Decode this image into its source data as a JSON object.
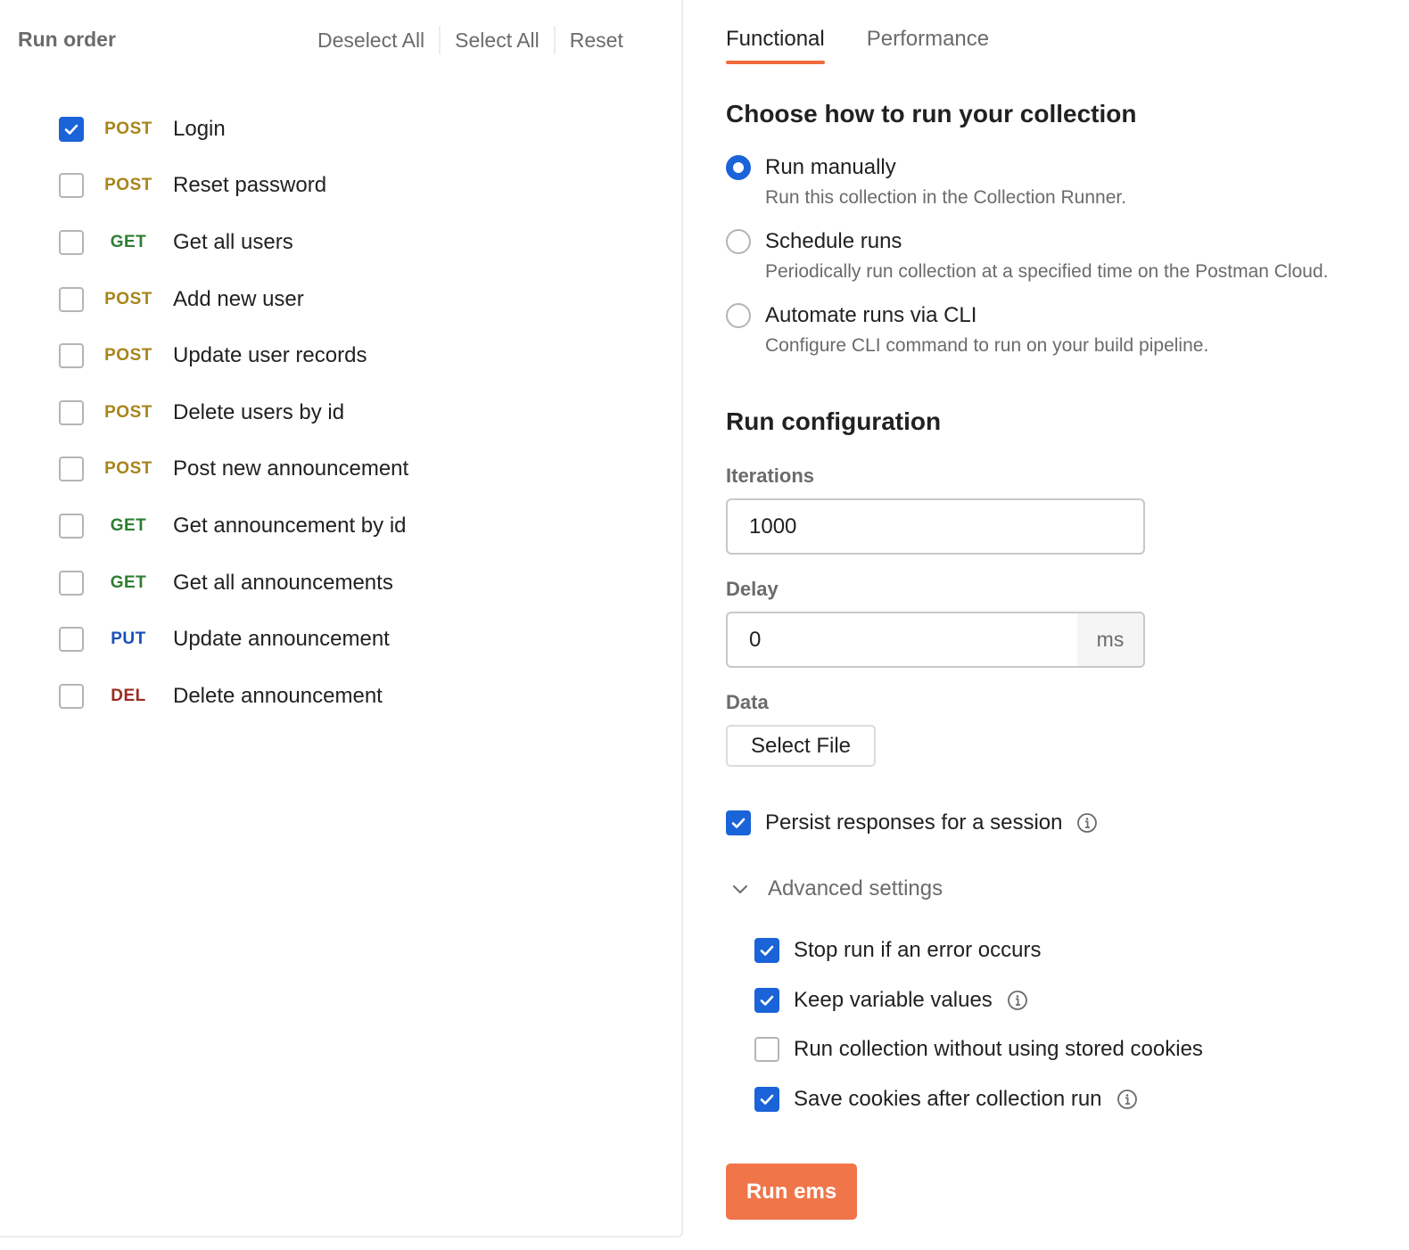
{
  "left": {
    "title": "Run order",
    "actions": {
      "deselect_all": "Deselect All",
      "select_all": "Select All",
      "reset": "Reset"
    },
    "requests": [
      {
        "method": "POST",
        "name": "Login",
        "checked": true
      },
      {
        "method": "POST",
        "name": "Reset password",
        "checked": false
      },
      {
        "method": "GET",
        "name": "Get all users",
        "checked": false
      },
      {
        "method": "POST",
        "name": "Add new user",
        "checked": false
      },
      {
        "method": "POST",
        "name": "Update user records",
        "checked": false
      },
      {
        "method": "POST",
        "name": "Delete users by id",
        "checked": false
      },
      {
        "method": "POST",
        "name": "Post new announcement",
        "checked": false
      },
      {
        "method": "GET",
        "name": "Get announcement by id",
        "checked": false
      },
      {
        "method": "GET",
        "name": "Get all announcements",
        "checked": false
      },
      {
        "method": "PUT",
        "name": "Update announcement",
        "checked": false
      },
      {
        "method": "DEL",
        "name": "Delete announcement",
        "checked": false
      }
    ]
  },
  "method_colors": {
    "POST": "#a8841a",
    "GET": "#2e7d32",
    "PUT": "#1a4fb8",
    "DEL": "#9c2a1f"
  },
  "tabs": {
    "functional": "Functional",
    "performance": "Performance",
    "active": "functional"
  },
  "run_mode": {
    "title": "Choose how to run your collection",
    "options": [
      {
        "label": "Run manually",
        "desc": "Run this collection in the Collection Runner.",
        "selected": true
      },
      {
        "label": "Schedule runs",
        "desc": "Periodically run collection at a specified time on the Postman Cloud.",
        "selected": false
      },
      {
        "label": "Automate runs via CLI",
        "desc": "Configure CLI command to run on your build pipeline.",
        "selected": false
      }
    ]
  },
  "config": {
    "title": "Run configuration",
    "iterations_label": "Iterations",
    "iterations_value": "1000",
    "delay_label": "Delay",
    "delay_value": "0",
    "delay_unit": "ms",
    "data_label": "Data",
    "select_file": "Select File",
    "persist_label": "Persist responses for a session",
    "persist_checked": true,
    "advanced_label": "Advanced settings",
    "advanced_expanded": true,
    "advanced_options": [
      {
        "label": "Stop run if an error occurs",
        "checked": true,
        "info": false
      },
      {
        "label": "Keep variable values",
        "checked": true,
        "info": true
      },
      {
        "label": "Run collection without using stored cookies",
        "checked": false,
        "info": false
      },
      {
        "label": "Save cookies after collection run",
        "checked": true,
        "info": true
      }
    ],
    "run_button": "Run ems"
  },
  "colors": {
    "accent": "#f0764a",
    "tab_underline": "#f26b3a",
    "check_blue": "#1a63d8"
  }
}
